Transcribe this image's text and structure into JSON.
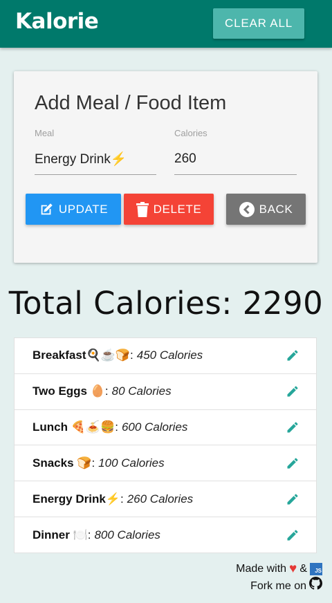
{
  "navbar": {
    "brand": "Kalorie",
    "clear_label": "CLEAR ALL"
  },
  "form": {
    "title": "Add Meal / Food Item",
    "meal_label": "Meal",
    "meal_value": "Energy Drink⚡",
    "calories_label": "Calories",
    "calories_value": "260",
    "update_label": "UPDATE",
    "delete_label": "DELETE",
    "back_label": "BACK"
  },
  "total": {
    "text": "Total Calories: 2290",
    "value": 2290
  },
  "items": [
    {
      "name": "Breakfast🍳☕🍞",
      "calories": "450 Calories"
    },
    {
      "name": "Two Eggs 🥚",
      "calories": "80 Calories"
    },
    {
      "name": "Lunch 🍕🍝🍔",
      "calories": "600 Calories"
    },
    {
      "name": "Snacks 🍞",
      "calories": "100 Calories"
    },
    {
      "name": "Energy Drink⚡",
      "calories": "260 Calories"
    },
    {
      "name": "Dinner 🍽️",
      "calories": "800 Calories"
    }
  ],
  "footer": {
    "made_with": "Made with",
    "amp": "&",
    "js_badge": "JS",
    "fork": "Fork me on"
  },
  "icons": {
    "edit": "pencil-icon",
    "update": "edit-square-icon",
    "delete": "trash-icon",
    "back": "chevron-left-circle-icon",
    "github": "github-icon",
    "heart": "heart-icon"
  },
  "colors": {
    "primary": "#00796b",
    "accent": "#4db6ac",
    "update": "#2196f3",
    "delete": "#f44336",
    "back": "#757575",
    "pencil": "#26a69a"
  }
}
